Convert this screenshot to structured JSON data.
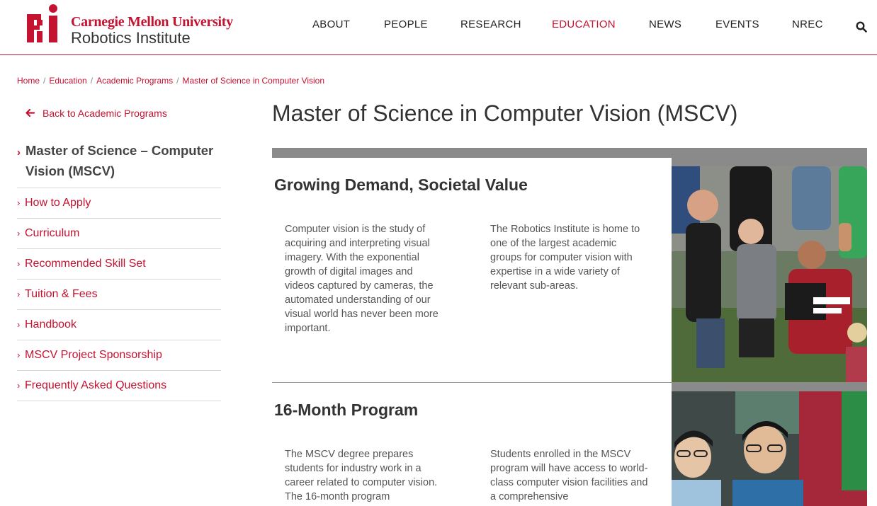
{
  "header": {
    "logo": {
      "university": "Carnegie Mellon University",
      "institute": "Robotics Institute",
      "mark_text": "Ri",
      "brand_color": "#c41230"
    },
    "nav": [
      {
        "label": "ABOUT",
        "active": false
      },
      {
        "label": "PEOPLE",
        "active": false
      },
      {
        "label": "RESEARCH",
        "active": false
      },
      {
        "label": "EDUCATION",
        "active": true
      },
      {
        "label": "NEWS",
        "active": false
      },
      {
        "label": "EVENTS",
        "active": false
      },
      {
        "label": "NREC",
        "active": false
      }
    ],
    "search_icon": "search-icon"
  },
  "breadcrumb": [
    "Home",
    "Education",
    "Academic Programs",
    "Master of Science in Computer Vision"
  ],
  "sidebar": {
    "back_link": "Back to Academic Programs",
    "items": [
      {
        "label": "Master of Science – Computer Vision (MSCV)",
        "current": true
      },
      {
        "label": "How to Apply",
        "current": false
      },
      {
        "label": "Curriculum",
        "current": false
      },
      {
        "label": "Recommended Skill Set",
        "current": false
      },
      {
        "label": "Tuition & Fees",
        "current": false
      },
      {
        "label": "Handbook",
        "current": false
      },
      {
        "label": "MSCV Project Sponsorship",
        "current": false
      },
      {
        "label": "Frequently Asked Questions",
        "current": false
      }
    ]
  },
  "main": {
    "title": "Master of Science in Computer Vision (MSCV)",
    "sections": [
      {
        "heading": "Growing Demand, Societal Value",
        "col1": "Computer vision is the study of acquiring and interpreting visual imagery. With the exponential growth of digital images and videos captured by cameras, the automated understanding of our visual world has never been more important.",
        "col2": "The Robotics Institute is home to one of the largest academic groups for computer vision with expertise in a wide variety of relevant sub-areas.",
        "photo": {
          "shirt_text": "ROBOTICS INSTITUTE",
          "shirt_text_2": "SITE FORCE"
        }
      },
      {
        "heading": "16-Month Program",
        "col1": "The MSCV degree prepares students for industry work in a career related to computer vision. The 16-month program",
        "col2": "Students enrolled in the MSCV program will have access to world-class computer vision facilities and a comprehensive"
      }
    ]
  }
}
